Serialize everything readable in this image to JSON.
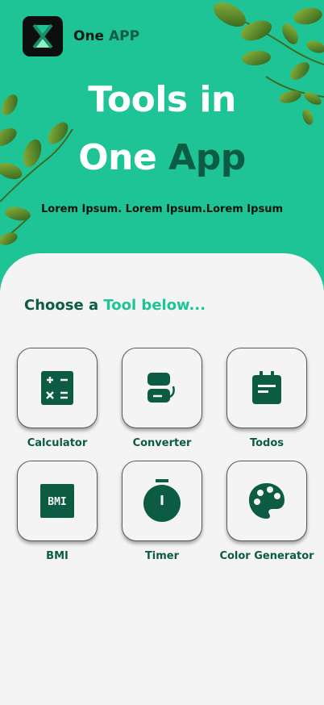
{
  "brand": {
    "name_part1": "One",
    "name_part2": "APP",
    "logo_icon": "hourglass-x-logo-icon"
  },
  "hero": {
    "title_line1": "Tools in",
    "title_line2_part1": "One",
    "title_line2_part2": "App",
    "subtitle": "Lorem Ipsum. Lorem Ipsum.Lorem Ipsum"
  },
  "section": {
    "title_part1": "Choose a",
    "title_part2": "Tool below..."
  },
  "tools": [
    {
      "label": "Calculator",
      "icon": "calculator-icon"
    },
    {
      "label": "Converter",
      "icon": "converter-icon"
    },
    {
      "label": "Todos",
      "icon": "clipboard-icon"
    },
    {
      "label": "BMI",
      "icon": "bmi-icon",
      "icon_text": "BMI"
    },
    {
      "label": "Timer",
      "icon": "stopwatch-icon"
    },
    {
      "label": "Color Generator",
      "icon": "palette-icon"
    }
  ],
  "colors": {
    "hero_background": "#1ec495",
    "primary_dark": "#0c5b43",
    "accent": "#1ec495",
    "page_background": "#f4f4f4"
  }
}
